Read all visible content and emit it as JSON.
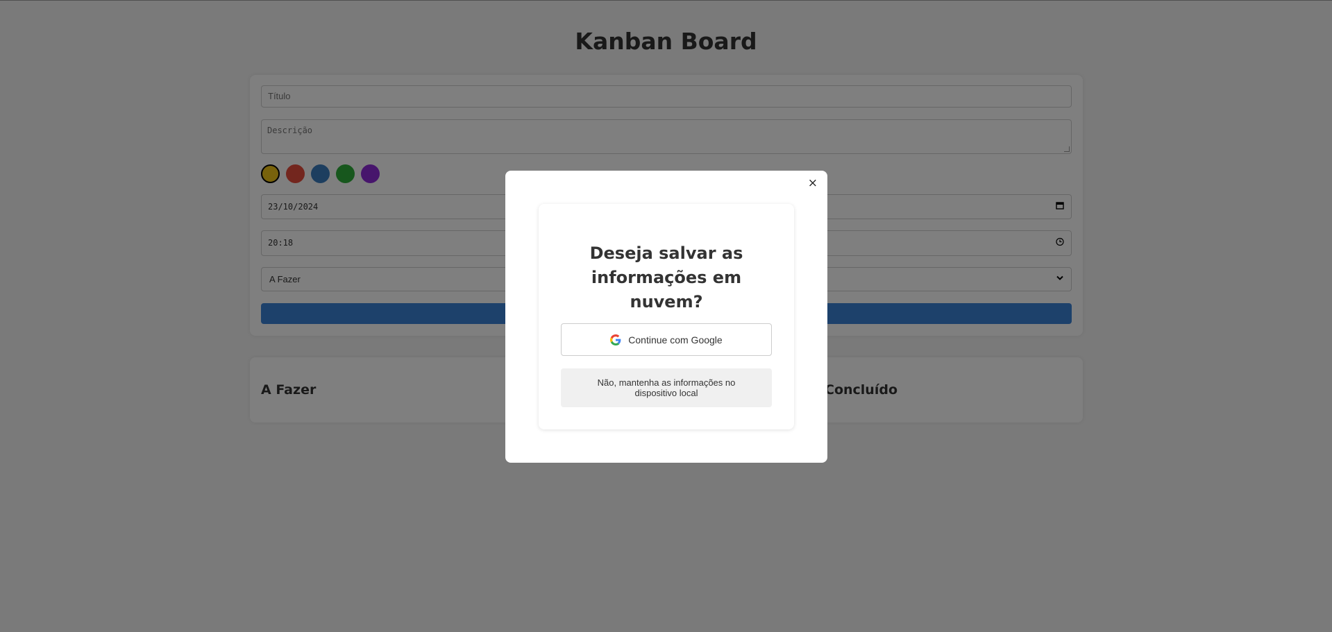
{
  "page": {
    "title": "Kanban Board"
  },
  "form": {
    "title_placeholder": "Título",
    "description_placeholder": "Descrição",
    "colors": [
      "#f0c419",
      "#e74c3c",
      "#3b7dbf",
      "#2fae3a",
      "#8e2bd9"
    ],
    "selected_color_index": 0,
    "date_value": "23/10/2024",
    "time_value": "20:18",
    "status_value": "A Fazer",
    "button_color": "#3b82d6"
  },
  "columns": [
    {
      "title": "A Fazer"
    },
    {
      "title": ""
    },
    {
      "title": "Concluído"
    }
  ],
  "modal": {
    "close_label": "×",
    "question": "Deseja salvar as informações em nuvem?",
    "google_button_label": "Continue com Google",
    "local_button_label": "Não, mantenha as informações no dispositivo local"
  }
}
